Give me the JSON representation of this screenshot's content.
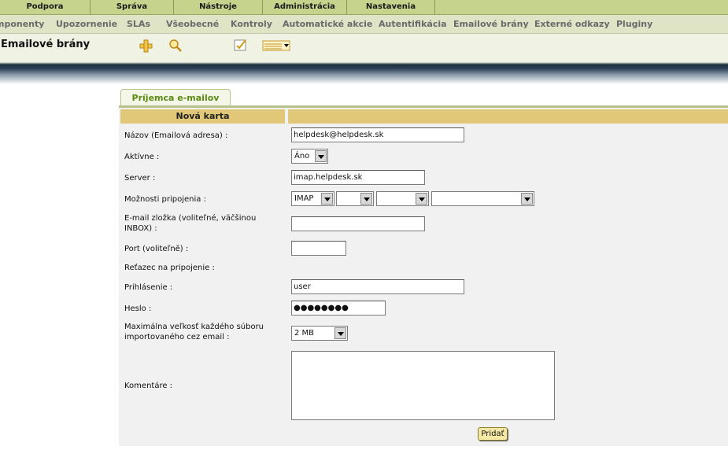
{
  "top_menu": [
    "Podpora",
    "Správa",
    "Nástroje",
    "Administrácia",
    "Nastavenia"
  ],
  "sub_menu": [
    "mponenty",
    "Upozornenie",
    "SLAs",
    "Všeobecné",
    "Kontroly",
    "Automatické akcie",
    "Autentifikácia",
    "Emailové brány",
    "Externé odkazy",
    "Pluginy"
  ],
  "page_title": "Emailové brány",
  "tab_label": "Príjemca e-mailov",
  "form": {
    "header": "Nová karta",
    "name_label": "Názov (Emailová adresa) :",
    "name_value": "helpdesk@helpdesk.sk",
    "active_label": "Aktívne :",
    "active_value": "Áno",
    "server_label": "Server :",
    "server_value": "imap.helpdesk.sk",
    "conn_label": "Možnosti pripojenia :",
    "conn_protocol": "IMAP",
    "conn_opt2": "",
    "conn_opt3": "",
    "conn_opt4": "",
    "folder_label": "E-mail zložka (voliteľné, väčšinou INBOX) :",
    "folder_value": "",
    "port_label": "Port (voliteľně) :",
    "port_value": "",
    "conn_string_label": "Reťazec na pripojenie :",
    "login_label": "Prihlásenie :",
    "login_value": "user",
    "password_label": "Heslo :",
    "password_value": "●●●●●●●●",
    "maxsize_label": "Maximálna veľkosť každého súboru importovaného cez email :",
    "maxsize_value": "2 MB",
    "comment_label": "Komentáre :",
    "submit_label": "Pridať"
  },
  "colors": {
    "top_menu_bg": "#c6d38d",
    "sub_menu_bg": "#dfe4c6",
    "header_bg": "#e1c778",
    "tab_text": "#5a8a12"
  }
}
